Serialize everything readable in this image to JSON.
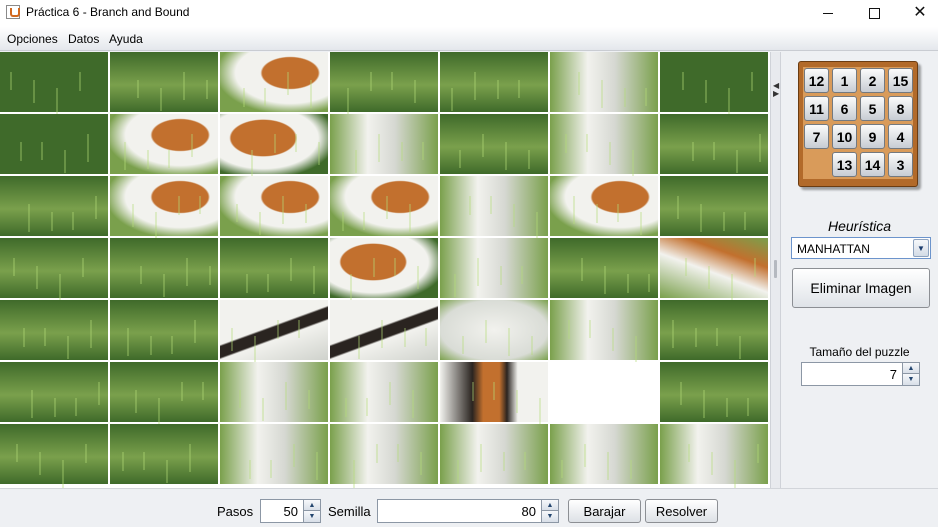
{
  "window": {
    "title": "Práctica 6 - Branch and Bound",
    "controls": {
      "minimize": "—",
      "maximize": "☐",
      "close": "✕"
    }
  },
  "menu": [
    "Opciones",
    "Datos",
    "Ayuda"
  ],
  "puzzle": {
    "rows": 7,
    "cols": 7,
    "empty_tile": {
      "row": 5,
      "col": 5
    },
    "image": "beagle-dog-on-grass",
    "colors": {
      "grass_dark": "#3f6a2a",
      "grass_light": "#7aa04c",
      "dog_white": "#f2f2ee",
      "dog_tan": "#c2702e",
      "dog_black": "#2a2420"
    }
  },
  "mini_puzzle": {
    "tiles": [
      "12",
      "1",
      "2",
      "15",
      "11",
      "6",
      "5",
      "8",
      "7",
      "10",
      "9",
      "4",
      "",
      "13",
      "14",
      "3"
    ]
  },
  "heuristic": {
    "label": "Heurística",
    "selected": "MANHATTAN"
  },
  "remove_image_button": "Eliminar Imagen",
  "puzzle_size": {
    "label": "Tamaño del puzzle",
    "value": "7"
  },
  "bottom": {
    "steps_label": "Pasos",
    "steps_value": "50",
    "seed_label": "Semilla",
    "seed_value": "80",
    "shuffle_button": "Barajar",
    "solve_button": "Resolver"
  }
}
